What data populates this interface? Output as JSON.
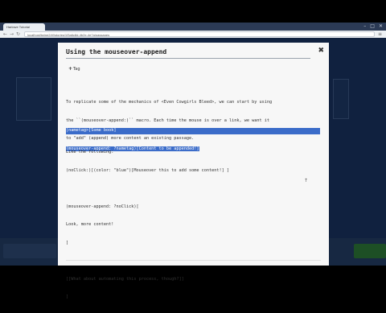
{
  "browser": {
    "tab_title": "Harlowe Tutorial",
    "url": "localhost/twine2/#!/stories/1f3a6c8d-4b2e-4e7a/passages"
  },
  "icons": {
    "back": "back-arrow-icon",
    "forward": "forward-arrow-icon",
    "reload": "reload-icon",
    "menu": "menu-icon",
    "close": "close-icon",
    "tag": "plus-icon"
  },
  "modal": {
    "title": "Using the mouseover-append",
    "tag_label": "Tag",
    "intro_lines": [
      "To replicate some of the mechanics of <Even Cowgirls Bleed>, we can start by using",
      "the ``(mouseover-append:)`` macro. Each time the mouse is over a link, we want it",
      "to \"add\" (append) more content an existing passage."
    ],
    "selected_lines": [
      "|nametag>[Some book]",
      "(mouseover-append: ?nametag)[Content to be appended!]"
    ],
    "body_lines": [
      "Like the following:",
      "(noClick:)[(color: \"blue\")[Mouseover this to add some content!] ]",
      "",
      "(mouseover-append: ?noClick)[",
      "Look, more content!",
      "]",
      "",
      "[[What about automating this process, though?]]",
      "]"
    ]
  },
  "colors": {
    "app_background": "#1a3461",
    "selection": "#3b6cc9",
    "modal_background": "#f7f7f7"
  }
}
